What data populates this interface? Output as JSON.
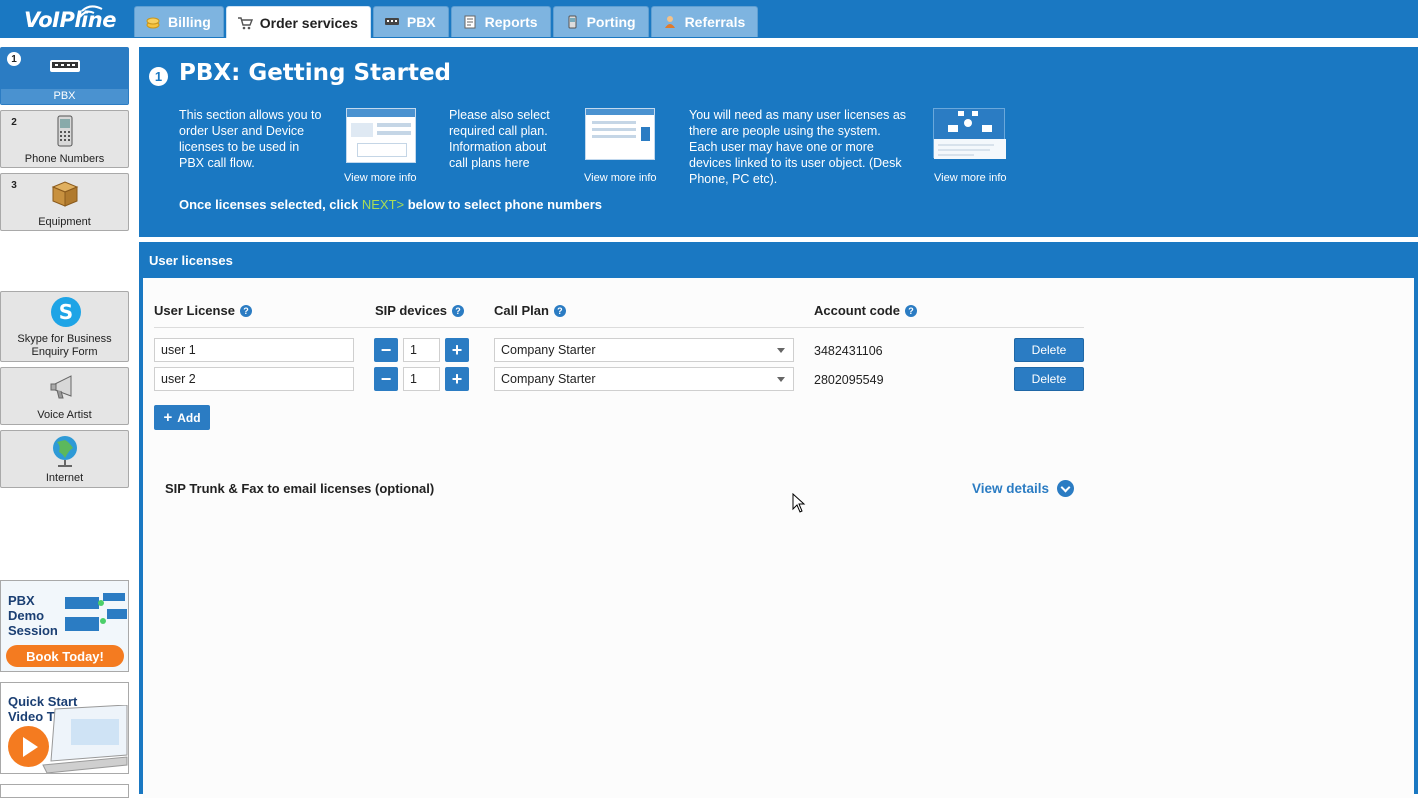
{
  "brand": {
    "logo_text": "VoIPline"
  },
  "tabs": [
    {
      "label": "Billing",
      "icon": "coins-icon"
    },
    {
      "label": "Order services",
      "icon": "cart-icon",
      "active": true
    },
    {
      "label": "PBX",
      "icon": "pbx-device-icon"
    },
    {
      "label": "Reports",
      "icon": "report-icon"
    },
    {
      "label": "Porting",
      "icon": "phone-port-icon"
    },
    {
      "label": "Referrals",
      "icon": "person-icon"
    }
  ],
  "sidebar": {
    "steps": [
      {
        "num": "1",
        "label": "PBX",
        "icon": "pbx-device-icon",
        "active": true
      },
      {
        "num": "2",
        "label": "Phone Numbers",
        "icon": "mobile-phone-icon"
      },
      {
        "num": "3",
        "label": "Equipment",
        "icon": "box-icon"
      }
    ],
    "extras": [
      {
        "label_line1": "Skype for Business",
        "label_line2": "Enquiry Form",
        "icon": "skype-icon"
      },
      {
        "label_line1": "Voice Artist",
        "icon": "megaphone-icon"
      },
      {
        "label_line1": "Internet",
        "icon": "globe-icon"
      }
    ],
    "promos": {
      "demo_line1": "PBX",
      "demo_line2": "Demo",
      "demo_line3": "Session",
      "demo_button": "Book Today!",
      "video_line1": "Quick Start",
      "video_line2": "Video Tutorial"
    }
  },
  "getting_started": {
    "num": "1",
    "title": "PBX: Getting Started",
    "blocks": [
      {
        "text": [
          "This section allows you to",
          "order User and Device",
          "licenses to be used in",
          "PBX call flow."
        ],
        "link": "View more info"
      },
      {
        "text": [
          "Please also select",
          "required call plan.",
          "Information about",
          "call plans here"
        ],
        "link": "View more info"
      },
      {
        "text": [
          "You will need as many user licenses as",
          "there are people using the system.",
          "Each user may have one or more",
          "devices linked to its user object. (Desk",
          "Phone, PC etc)."
        ],
        "link": "View more info"
      }
    ],
    "once_pre": "Once licenses selected, click ",
    "once_next": "NEXT>",
    "once_post": " below to select phone numbers"
  },
  "user_licenses": {
    "header": "User licenses",
    "columns": {
      "user_license": "User License",
      "sip_devices": "SIP devices",
      "call_plan": "Call Plan",
      "account_code": "Account code"
    },
    "help_glyph": "?",
    "rows": [
      {
        "user": "user 1",
        "devices": "1",
        "plan": "Company Starter",
        "account": "3482431106",
        "delete": "Delete"
      },
      {
        "user": "user 2",
        "devices": "1",
        "plan": "Company Starter",
        "account": "2802095549",
        "delete": "Delete"
      }
    ],
    "add_label": "Add",
    "sip_trunk_title": "SIP Trunk & Fax to email licenses (optional)",
    "view_details": "View details"
  },
  "colors": {
    "brand_blue": "#1a78c2",
    "button_blue": "#2b7cc3",
    "next_green": "#a8dc56",
    "promo_orange": "#f47b20"
  }
}
